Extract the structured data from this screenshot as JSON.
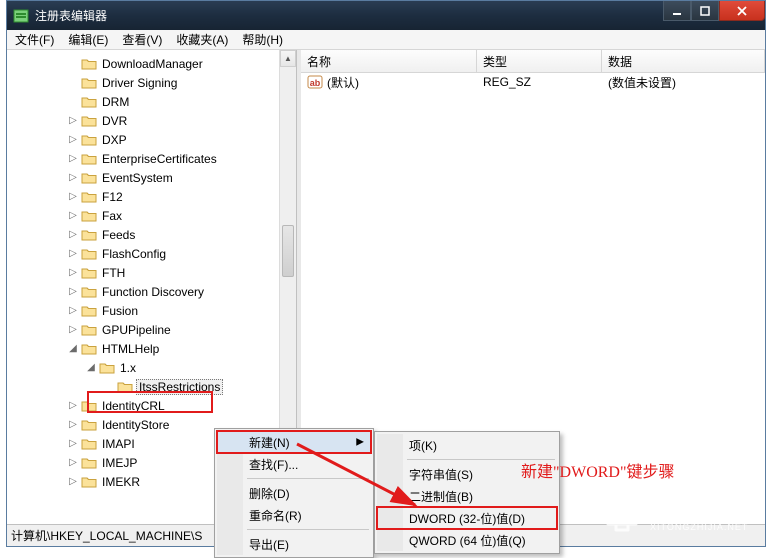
{
  "window": {
    "title": "注册表编辑器"
  },
  "menu": {
    "file": "文件(F)",
    "edit": "编辑(E)",
    "view": "查看(V)",
    "fav": "收藏夹(A)",
    "help": "帮助(H)"
  },
  "tree": [
    {
      "indent": 3,
      "tw": "",
      "label": "DownloadManager"
    },
    {
      "indent": 3,
      "tw": "",
      "label": "Driver Signing"
    },
    {
      "indent": 3,
      "tw": "",
      "label": "DRM"
    },
    {
      "indent": 3,
      "tw": "▷",
      "label": "DVR"
    },
    {
      "indent": 3,
      "tw": "▷",
      "label": "DXP"
    },
    {
      "indent": 3,
      "tw": "▷",
      "label": "EnterpriseCertificates"
    },
    {
      "indent": 3,
      "tw": "▷",
      "label": "EventSystem"
    },
    {
      "indent": 3,
      "tw": "▷",
      "label": "F12"
    },
    {
      "indent": 3,
      "tw": "▷",
      "label": "Fax"
    },
    {
      "indent": 3,
      "tw": "▷",
      "label": "Feeds"
    },
    {
      "indent": 3,
      "tw": "▷",
      "label": "FlashConfig"
    },
    {
      "indent": 3,
      "tw": "▷",
      "label": "FTH"
    },
    {
      "indent": 3,
      "tw": "▷",
      "label": "Function Discovery"
    },
    {
      "indent": 3,
      "tw": "▷",
      "label": "Fusion"
    },
    {
      "indent": 3,
      "tw": "▷",
      "label": "GPUPipeline"
    },
    {
      "indent": 3,
      "tw": "◢",
      "label": "HTMLHelp"
    },
    {
      "indent": 4,
      "tw": "◢",
      "label": "1.x"
    },
    {
      "indent": 5,
      "tw": "",
      "label": "ItssRestrictions",
      "selected": true
    },
    {
      "indent": 3,
      "tw": "▷",
      "label": "IdentityCRL"
    },
    {
      "indent": 3,
      "tw": "▷",
      "label": "IdentityStore"
    },
    {
      "indent": 3,
      "tw": "▷",
      "label": "IMAPI"
    },
    {
      "indent": 3,
      "tw": "▷",
      "label": "IMEJP"
    },
    {
      "indent": 3,
      "tw": "▷",
      "label": "IMEKR"
    }
  ],
  "list": {
    "headers": {
      "name": "名称",
      "type": "类型",
      "data": "数据"
    },
    "rows": [
      {
        "name": "(默认)",
        "type": "REG_SZ",
        "data": "(数值未设置)"
      }
    ]
  },
  "status": {
    "path": "计算机\\HKEY_LOCAL_MACHINE\\S"
  },
  "ctx1": {
    "new": "新建(N)",
    "find": "查找(F)...",
    "delete": "删除(D)",
    "rename": "重命名(R)",
    "export": "导出(E)"
  },
  "ctx2": {
    "key": "项(K)",
    "string": "字符串值(S)",
    "binary": "二进制值(B)",
    "dword": "DWORD (32-位)值(D)",
    "qword": "QWORD (64 位)值(Q)"
  },
  "annotation": {
    "text": "新建\"DWORD\"键步骤"
  },
  "watermark": {
    "brand": "系统之家",
    "url": "XITONGZHIJIA.NET"
  }
}
